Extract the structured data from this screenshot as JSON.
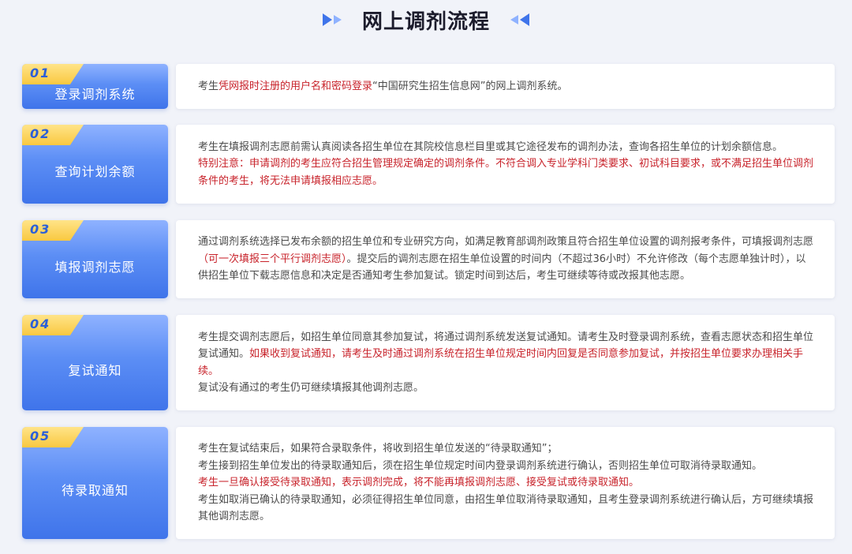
{
  "header": {
    "title": "网上调剂流程"
  },
  "colors": {
    "accent_blue": "#4f86f0",
    "tab_yellow": "#f9c840",
    "highlight_red": "#c8232b",
    "body_text": "#4a4a4a"
  },
  "steps": [
    {
      "num": "01",
      "name": "登录调剂系统",
      "desc": {
        "l1a": "考生",
        "l1b": "凭网报时注册的用户名和密码登录",
        "l1c": "“中国研究生招生信息网”的网上调剂系统。"
      }
    },
    {
      "num": "02",
      "name": "查询计划余额",
      "desc": {
        "l1": "考生在填报调剂志愿前需认真阅读各招生单位在其院校信息栏目里或其它途径发布的调剂办法，查询各招生单位的计划余额信息。",
        "l2": "特别注意：申请调剂的考生应符合招生管理规定确定的调剂条件。不符合调入专业学科门类要求、初试科目要求，或不满足招生单位调剂条件的考生，将无法申请填报相应志愿。"
      }
    },
    {
      "num": "03",
      "name": "填报调剂志愿",
      "desc": {
        "l1a": "通过调剂系统选择已发布余额的招生单位和专业研究方向，如满足教育部调剂政策且符合招生单位设置的调剂报考条件，可填报调剂志愿",
        "l1b": "（可一次填报三个平行调剂志愿）",
        "l1c": "。提交后的调剂志愿在招生单位设置的时间内（不超过36小时）不允许修改（每个志愿单独计时），以供招生单位下载志愿信息和决定是否通知考生参加复试。锁定时间到达后，考生可继续等待或改报其他志愿。"
      }
    },
    {
      "num": "04",
      "name": "复试通知",
      "desc": {
        "l1a": "考生提交调剂志愿后，如招生单位同意其参加复试，将通过调剂系统发送复试通知。请考生及时登录调剂系统，查看志愿状态和招生单位复试通知。",
        "l1b": "如果收到复试通知，请考生及时通过调剂系统在招生单位规定时间内回复是否同意参加复试，并按招生单位要求办理相关手续。",
        "l2": "复试没有通过的考生仍可继续填报其他调剂志愿。"
      }
    },
    {
      "num": "05",
      "name": "待录取通知",
      "desc": {
        "l1": "考生在复试结束后，如果符合录取条件，将收到招生单位发送的“待录取通知”；",
        "l2": "考生接到招生单位发出的待录取通知后，须在招生单位规定时间内登录调剂系统进行确认，否则招生单位可取消待录取通知。",
        "l3": "考生一旦确认接受待录取通知，表示调剂完成，将不能再填报调剂志愿、接受复试或待录取通知。",
        "l4": "考生如取消已确认的待录取通知，必须征得招生单位同意，由招生单位取消待录取通知，且考生登录调剂系统进行确认后，方可继续填报其他调剂志愿。"
      }
    }
  ]
}
